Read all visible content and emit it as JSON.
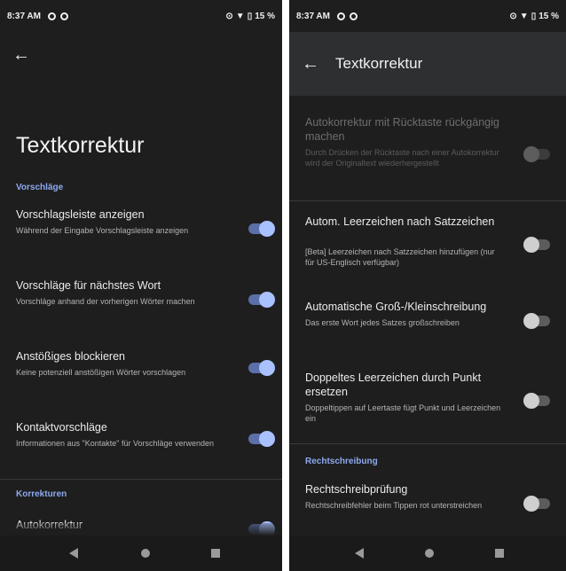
{
  "status_bar": {
    "time": "8:37 AM",
    "left_icons": [
      "gear-icon",
      "shield-icon"
    ],
    "right_text": "15 %",
    "right_icons": [
      "location-icon",
      "wifi-icon",
      "battery-icon"
    ]
  },
  "left_screen": {
    "title": "Textkorrektur",
    "back_icon": "arrow-left-icon",
    "section_suggestions": "Vorschläge",
    "section_corrections": "Korrekturen",
    "settings": [
      {
        "title": "Vorschlagsleiste anzeigen",
        "subtitle": "Während der Eingabe Vorschlagsleiste anzeigen",
        "enabled": true
      },
      {
        "title": "Vorschläge für nächstes Wort",
        "subtitle": "Vorschläge anhand der vorherigen Wörter machen",
        "enabled": true
      },
      {
        "title": "Anstößiges blockieren",
        "subtitle": "Keine potenziell anstößigen Wörter vorschlagen",
        "enabled": true
      },
      {
        "title": "Kontaktvorschläge",
        "subtitle": "Informationen aus \"Kontakte\" für Vorschläge verwenden",
        "enabled": true
      },
      {
        "title": "Autokorrektur",
        "subtitle": "",
        "enabled": true
      }
    ]
  },
  "right_screen": {
    "title": "Textkorrektur",
    "back_icon": "arrow-left-icon",
    "section_spelling": "Rechtschreibung",
    "settings": [
      {
        "title": "Autokorrektur mit Rücktaste rückgängig machen",
        "subtitle": "Durch Drücken der Rücktaste nach einer Autokorrektur wird der Originaltext wiederhergestellt",
        "enabled": false,
        "disabled": true
      },
      {
        "title": "Autom. Leerzeichen nach Satzzeichen",
        "subtitle": "[Beta] Leerzeichen nach Satzzeichen hinzufügen (nur für US-Englisch verfügbar)",
        "enabled": false
      },
      {
        "title": "Automatische Groß-/Kleinschreibung",
        "subtitle": "Das erste Wort jedes Satzes großschreiben",
        "enabled": false
      },
      {
        "title": "Doppeltes Leerzeichen durch Punkt ersetzen",
        "subtitle": "Doppeltippen auf Leertaste fügt Punkt und Leerzeichen ein",
        "enabled": false
      },
      {
        "title": "Rechtschreibprüfung",
        "subtitle": "Rechtschreibfehler beim Tippen rot unterstreichen",
        "enabled": false
      }
    ]
  },
  "nav_bar": {
    "icons": [
      "nav-back-icon",
      "nav-home-icon",
      "nav-recents-icon"
    ]
  },
  "colors": {
    "background": "#1e1e1e",
    "accent": "#8fa9ef",
    "toggle_on": "#a9c1ff",
    "toggle_off": "#cfcfcf"
  }
}
